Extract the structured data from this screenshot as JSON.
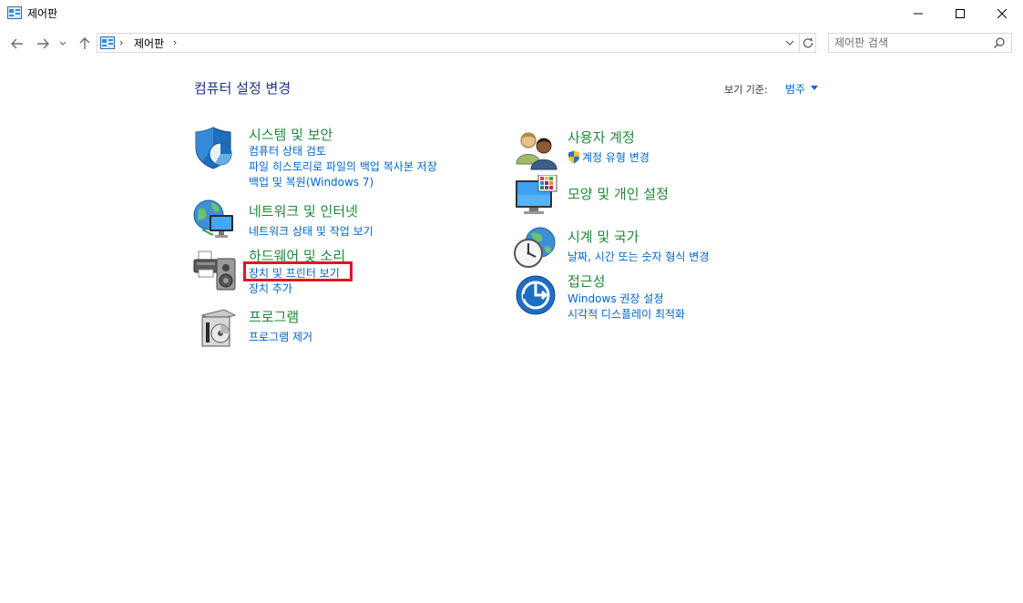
{
  "window": {
    "title": "제어판",
    "minimize_label": "—",
    "maximize_label": "☐",
    "close_label": "✕"
  },
  "nav": {
    "back_icon": "arrow-left-icon",
    "forward_icon": "arrow-right-icon",
    "recent_icon": "chevron-down-icon",
    "up_icon": "arrow-up-icon"
  },
  "address": {
    "crumb": "제어판",
    "separator": "›"
  },
  "search": {
    "placeholder": "제어판 검색"
  },
  "main": {
    "title": "컴퓨터 설정 변경",
    "view_by_label": "보기 기준:",
    "view_by_value": "범주"
  },
  "categories": {
    "system": {
      "title": "시스템 및 보안",
      "links": [
        "컴퓨터 상태 검토",
        "파일 히스토리로 파일의 백업 복사본 저장",
        "백업 및 복원(Windows 7)"
      ]
    },
    "network": {
      "title": "네트워크 및 인터넷",
      "links": [
        "네트워크 상태 및 작업 보기"
      ]
    },
    "hardware": {
      "title": "하드웨어 및 소리",
      "links": [
        "장치 및 프린터 보기",
        "장치 추가"
      ]
    },
    "programs": {
      "title": "프로그램",
      "links": [
        "프로그램 제거"
      ]
    },
    "users": {
      "title": "사용자 계정",
      "links": [
        "계정 유형 변경"
      ]
    },
    "appearance": {
      "title": "모양 및 개인 설정",
      "links": []
    },
    "clock": {
      "title": "시계 및 국가",
      "links": [
        "날짜, 시간 또는 숫자 형식 변경"
      ]
    },
    "ease": {
      "title": "접근성",
      "links": [
        "Windows 권장 설정",
        "시각적 디스플레이 최적화"
      ]
    }
  },
  "colors": {
    "category_green": "#1e8a3a",
    "link_blue": "#0066cc",
    "highlight_red": "#e5141e"
  }
}
